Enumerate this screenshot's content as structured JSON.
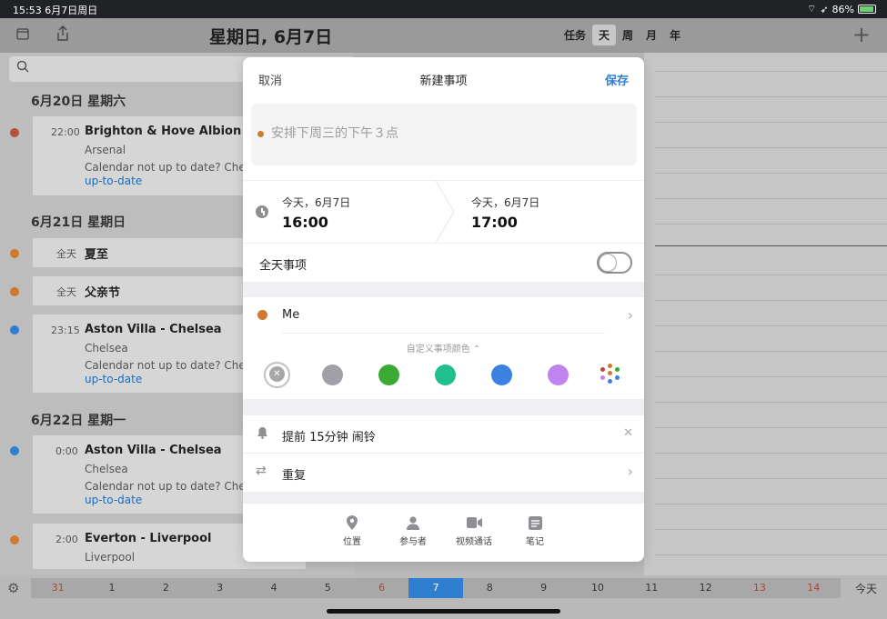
{
  "statusbar": {
    "time": "15:53",
    "date": "6月7日周日",
    "battery": "86%"
  },
  "header": {
    "title": "星期日, 6月7日",
    "views": [
      "任务",
      "天",
      "周",
      "月",
      "年"
    ],
    "active_view": "天"
  },
  "agenda": {
    "sections": [
      {
        "date": "6月20日 星期六",
        "events": [
          {
            "time": "22:00",
            "name": "Brighton & Hove Albion FC -",
            "sub": "Arsenal",
            "note": "Calendar not up to date? Check",
            "link": "up-to-date",
            "dot": "#b4513a"
          }
        ]
      },
      {
        "date": "6月21日 星期日",
        "events": [
          {
            "time": "全天",
            "name": "夏至",
            "dot": "#d07a2d"
          },
          {
            "time": "全天",
            "name": "父亲节",
            "dot": "#d07a2d"
          },
          {
            "time": "23:15",
            "name": "Aston Villa - Chelsea",
            "sub": "Chelsea",
            "note": "Calendar not up to date? Check",
            "link": "up-to-date",
            "dot": "#2f7fd0"
          }
        ]
      },
      {
        "date": "6月22日 星期一",
        "events": [
          {
            "time": "0:00",
            "name": "Aston Villa - Chelsea",
            "sub": "Chelsea",
            "note": "Calendar not up to date? Check",
            "link": "up-to-date",
            "dot": "#2f7fd0"
          },
          {
            "time": "2:00",
            "name": "Everton - Liverpool",
            "sub": "Liverpool",
            "dot": "#d07a2d"
          }
        ]
      }
    ]
  },
  "datestrip": {
    "days": [
      "31",
      "1",
      "2",
      "3",
      "4",
      "5",
      "6",
      "7",
      "8",
      "9",
      "10",
      "11",
      "12",
      "13",
      "14"
    ],
    "weekend_days": [
      "31",
      "6",
      "13",
      "14"
    ],
    "selected": "7",
    "today_label": "今天"
  },
  "modal": {
    "cancel": "取消",
    "title": "新建事项",
    "save": "保存",
    "title_placeholder": "安排下周三的下午３点",
    "start": {
      "day": "今天，6月7日",
      "time": "16:00"
    },
    "end": {
      "day": "今天，6月7日",
      "time": "17:00"
    },
    "all_day_label": "全天事项",
    "all_day": false,
    "calendar": "Me",
    "calendar_color": "#d07a2d",
    "custom_color_label": "自定义事项颜色",
    "color_swatches": [
      "none",
      "#a0a0a6",
      "#3aaa35",
      "#1fbf8e",
      "#3b82e0",
      "#c084f0"
    ],
    "alarm": "提前 15分钟 闹铃",
    "repeat": "重复",
    "toolbar": [
      "位置",
      "参与者",
      "视频通话",
      "笔记"
    ]
  }
}
